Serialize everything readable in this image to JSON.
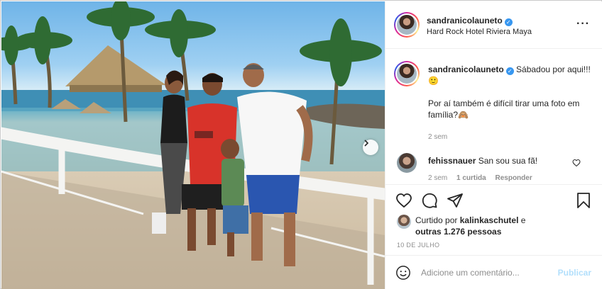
{
  "post": {
    "author": "sandranicolauneto",
    "location": "Hard Rock Hotel Riviera Maya",
    "verified": true,
    "more_icon": "more-options-icon"
  },
  "caption": {
    "author": "sandranicolauneto",
    "line1": "Sábadou por aqui!!!🙂",
    "line2": "Por aí também é difícil tirar uma foto em família?🙈",
    "time": "2 sem"
  },
  "comment": {
    "author": "fehissnauer",
    "text": "San sou sua fã!",
    "time": "2 sem",
    "likes": "1 curtida",
    "reply_label": "Responder"
  },
  "actions": {
    "icons": [
      "heart-icon",
      "comment-icon",
      "share-icon",
      "bookmark-icon"
    ]
  },
  "likes": {
    "prefix": "Curtido por",
    "user": "kalinkaschutel",
    "connector": "e",
    "others": "outras 1.276 pessoas"
  },
  "date": "10 DE JULHO",
  "add_comment": {
    "placeholder": "Adicione um comentário...",
    "publish_label": "Publicar"
  },
  "colors": {
    "accent": "#3897f0",
    "publish_disabled": "#b2dffc",
    "meta_text": "#8e8e8e"
  }
}
